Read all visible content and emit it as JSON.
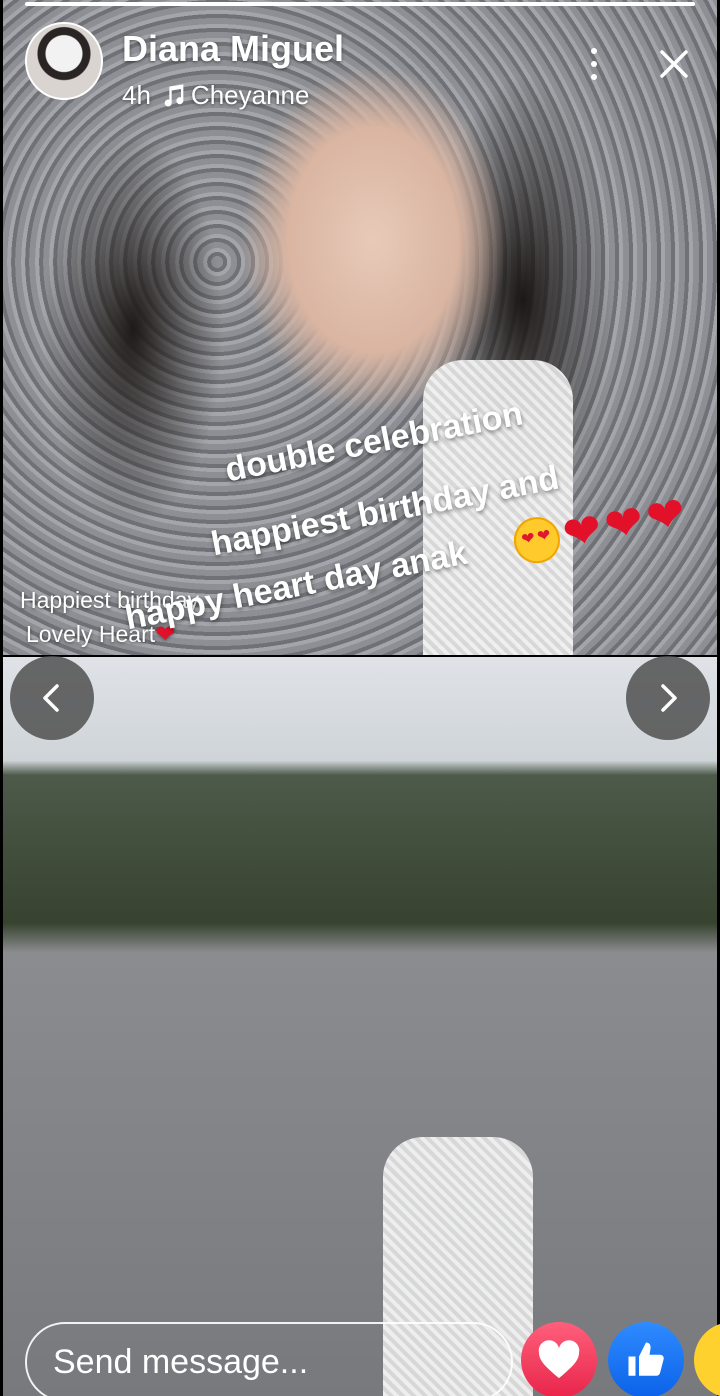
{
  "story": {
    "progress": 1.0,
    "user_name": "Diana Miguel",
    "time_ago": "4h",
    "song": "Cheyanne"
  },
  "overlay": {
    "caption_lines": [
      "double celebration",
      "happiest birthday and",
      "happy heart day anak"
    ],
    "small_caption_lines": [
      "Happiest birthday",
      "Lovely Heart"
    ]
  },
  "icons": {
    "music": "music-note-icon",
    "more": "more-vertical-icon",
    "close": "close-icon",
    "prev": "chevron-left-icon",
    "next": "chevron-right-icon"
  },
  "bottom_bar": {
    "placeholder": "Send message...",
    "reactions": [
      "love",
      "like",
      "haha"
    ]
  },
  "colors": {
    "love": "#e8254a",
    "like": "#0b62e8",
    "haha": "#ffd12e",
    "heart": "#e3102a"
  }
}
